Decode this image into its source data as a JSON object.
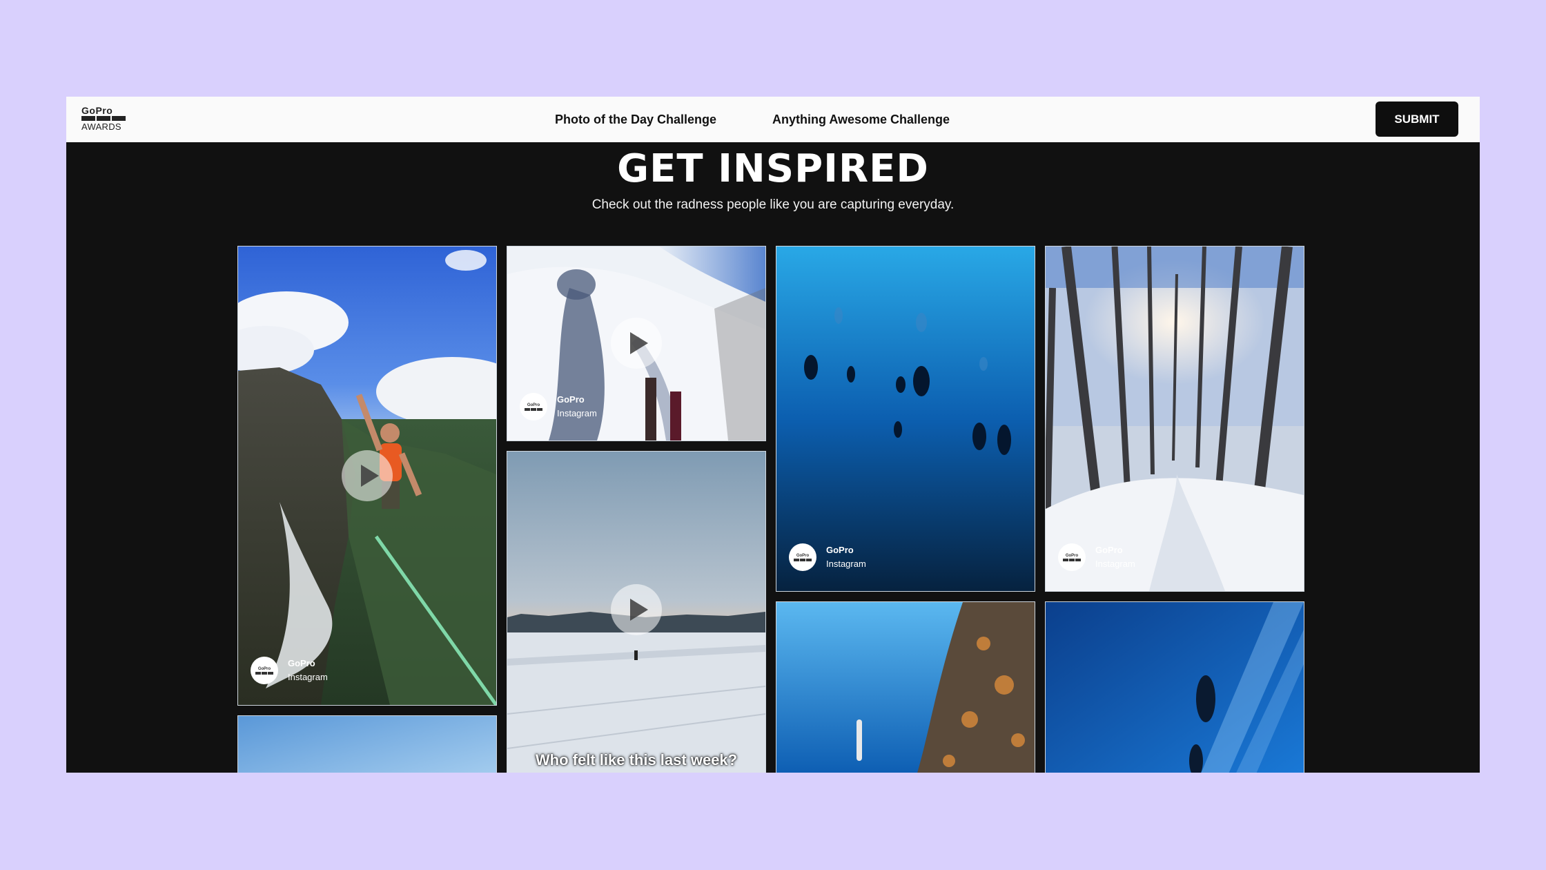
{
  "header": {
    "logo_brand": "GoPro",
    "logo_sub": "AWARDS",
    "nav": [
      "Photo of the Day Challenge",
      "Anything Awesome Challenge"
    ],
    "submit_label": "SUBMIT"
  },
  "hero": {
    "title": "GET INSPIRED",
    "subtitle": "Check out the radness people like you are capturing everyday."
  },
  "gallery": {
    "tiles": [
      {
        "subject": "slackline over waterfall",
        "has_play": true,
        "credit_name": "GoPro",
        "credit_source": "Instagram"
      },
      {
        "subject": "snow ski shadow",
        "has_play": true,
        "credit_name": "GoPro",
        "credit_source": "Instagram"
      },
      {
        "subject": "scuba divers in blue water",
        "has_play": false,
        "credit_name": "GoPro",
        "credit_source": "Instagram"
      },
      {
        "subject": "snowy forest path",
        "has_play": false,
        "credit_name": "GoPro",
        "credit_source": "Instagram"
      },
      {
        "subject": "sky",
        "has_play": false
      },
      {
        "subject": "frozen lake at dusk",
        "has_play": true,
        "caption": "Who felt like this last week?"
      },
      {
        "subject": "freediver by reef",
        "has_play": false
      },
      {
        "subject": "diver in sunrays",
        "has_play": false
      }
    ]
  },
  "colors": {
    "page_bg": "#d9d0fd",
    "frame_bg": "#111111",
    "topbar_bg": "#fafafa",
    "submit_bg": "#0e0e0e"
  }
}
